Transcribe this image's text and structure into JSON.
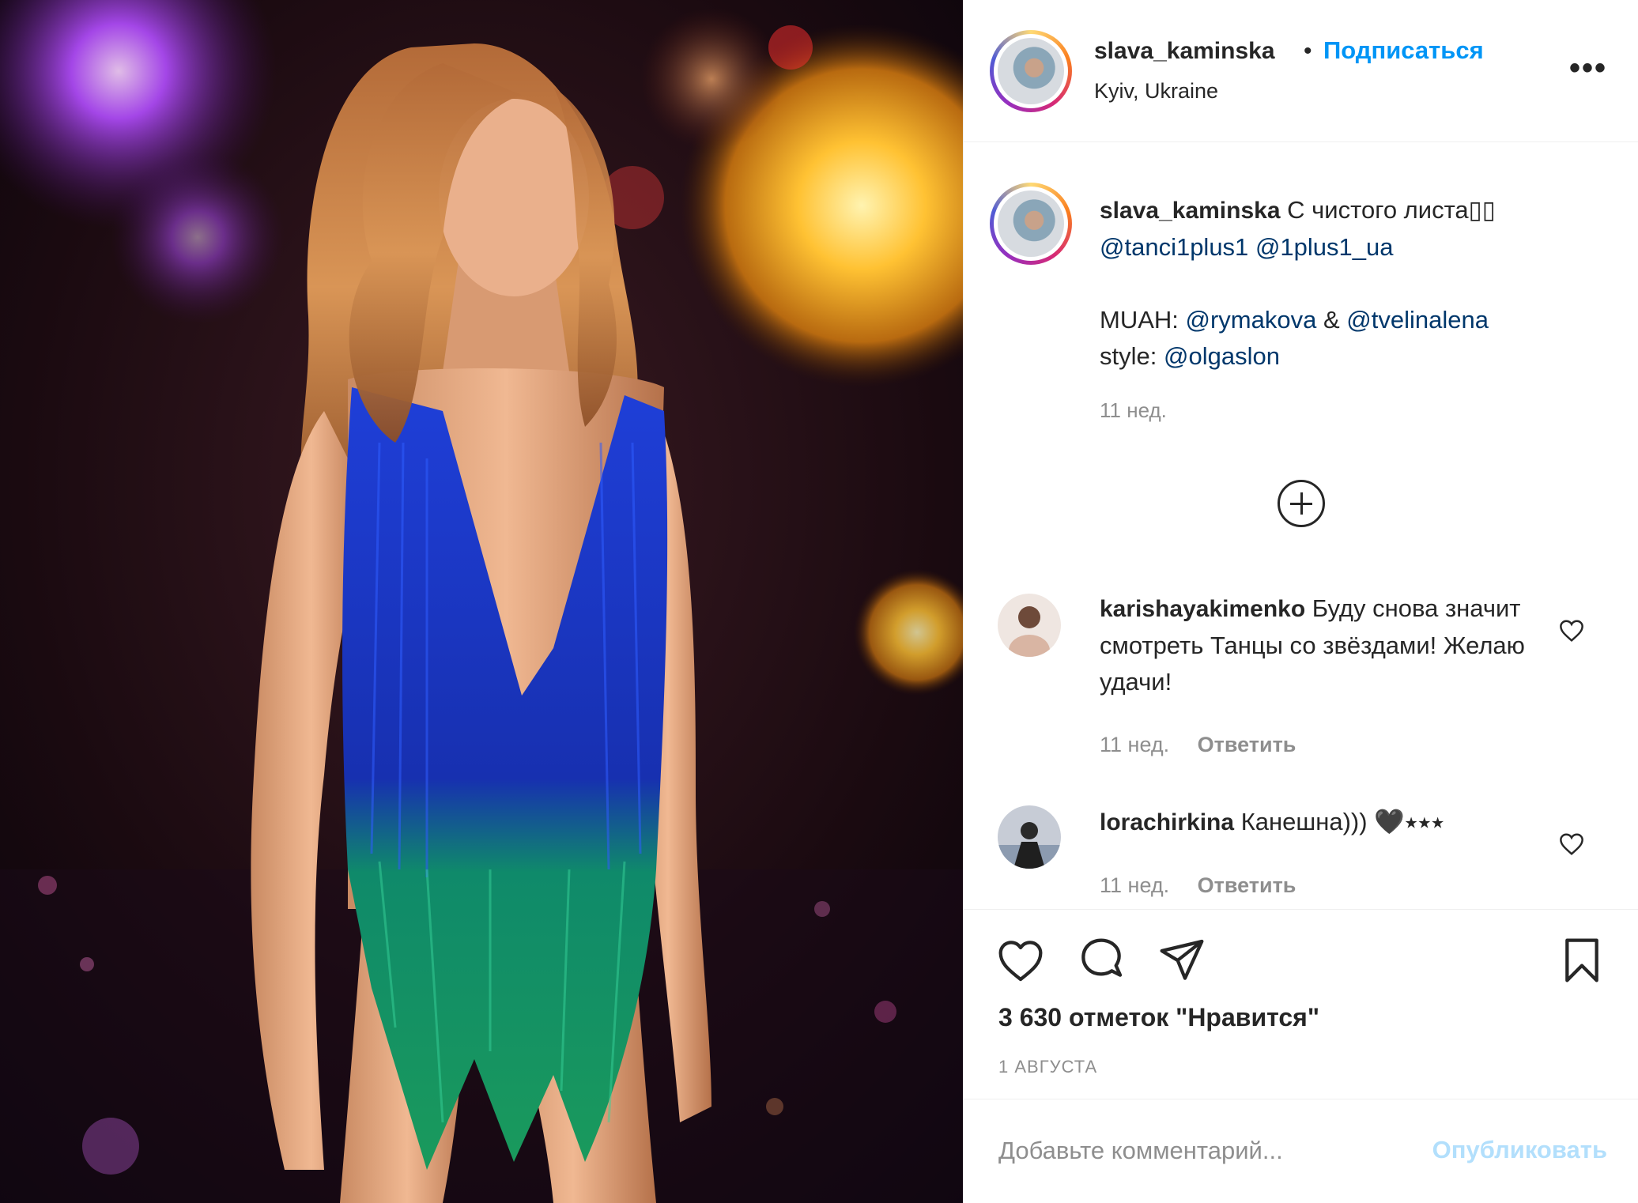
{
  "post": {
    "username": "slava_kaminska",
    "separator": "•",
    "follow_label": "Подписаться",
    "location": "Kyiv, Ukraine",
    "more_icon": "more-horizontal-icon",
    "more_label": "•••"
  },
  "caption": {
    "username": "slava_kaminska",
    "text": "С чистого листа▯▯",
    "mention_1": "@tanci1plus1",
    "mention_2": "@1plus1_ua",
    "muah_label": "MUAH:",
    "mention_3": "@rymakova",
    "amp": "&",
    "mention_4": "@tvelinalena",
    "style_label": "style:",
    "mention_5": "@olgaslon",
    "time": "11 нед."
  },
  "load_more_icon": "plus-circle-icon",
  "comments": [
    {
      "username": "karishayakimenko",
      "text": "Буду снова значит смотреть Танцы со звёздами! Желаю удачи!",
      "time": "11 нед.",
      "reply_label": "Ответить"
    },
    {
      "username": "lorachirkina",
      "text": "Канешна))) 🖤⭑⭑⭑",
      "time": "11 нед.",
      "reply_label": "Ответить"
    }
  ],
  "actions": {
    "like_icon": "heart-icon",
    "comment_icon": "comment-icon",
    "share_icon": "paper-plane-icon",
    "save_icon": "bookmark-icon",
    "likes_text": "3 630 отметок \"Нравится\"",
    "date": "1 АВГУСТА"
  },
  "add_comment": {
    "placeholder": "Добавьте комментарий...",
    "publish_label": "Опубликовать"
  },
  "colors": {
    "accent": "#0095f6",
    "publish_disabled": "#b2dffc",
    "mention": "#00376b",
    "muted": "#8e8e8e",
    "text": "#262626"
  }
}
